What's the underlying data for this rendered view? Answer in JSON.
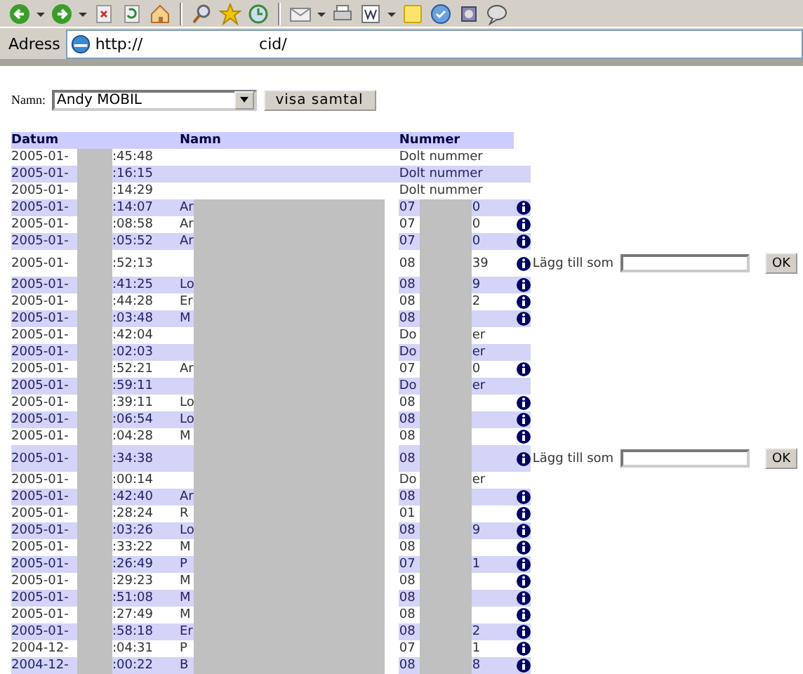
{
  "address_bar": {
    "label": "Adress",
    "url_start": "http://",
    "url_end": "cid/"
  },
  "form": {
    "label": "Namn:",
    "select_value": "Andy MOBIL",
    "button": "visa samtal"
  },
  "table": {
    "columns": [
      "Datum",
      "Namn",
      "Nummer"
    ],
    "rows": [
      {
        "date": "2005-01-",
        "time": ":45:48",
        "redacted": false,
        "name": "",
        "number": "Dolt nummer",
        "number_end": "",
        "info": false
      },
      {
        "date": "2005-01-",
        "time": ":16:15",
        "redacted": false,
        "name": "",
        "number": "Dolt nummer",
        "number_end": "",
        "info": false
      },
      {
        "date": "2005-01-",
        "time": ":14:29",
        "redacted": false,
        "name": "",
        "number": "Dolt nummer",
        "number_end": "",
        "info": false
      },
      {
        "date": "2005-01-",
        "time": ":14:07",
        "redacted": true,
        "name": "Ar",
        "number": "07",
        "number_end": "0",
        "info": true
      },
      {
        "date": "2005-01-",
        "time": ":08:58",
        "redacted": true,
        "name": "Ar",
        "number": "07",
        "number_end": "0",
        "info": true
      },
      {
        "date": "2005-01-",
        "time": ":05:52",
        "redacted": true,
        "name": "Ar",
        "number": "07",
        "number_end": "0",
        "info": true
      },
      {
        "date": "2005-01-",
        "time": ":52:13",
        "redacted": true,
        "name": "",
        "number": "08",
        "number_end": "39",
        "info": true,
        "add_form": {
          "label": "Lägg till som",
          "button": "OK"
        }
      },
      {
        "date": "2005-01-",
        "time": ":41:25",
        "redacted": true,
        "name": "Lo",
        "number": "08",
        "number_end": "9",
        "info": true
      },
      {
        "date": "2005-01-",
        "time": ":44:28",
        "redacted": true,
        "name": "Er",
        "number": "08",
        "number_end": "2",
        "info": true
      },
      {
        "date": "2005-01-",
        "time": ":03:48",
        "redacted": true,
        "name": "M",
        "number": "08",
        "number_end": "",
        "info": true
      },
      {
        "date": "2005-01-",
        "time": ":42:04",
        "redacted": true,
        "name": "",
        "number": "Do",
        "number_end": "er",
        "info": false
      },
      {
        "date": "2005-01-",
        "time": ":02:03",
        "redacted": true,
        "name": "",
        "number": "Do",
        "number_end": "er",
        "info": false
      },
      {
        "date": "2005-01-",
        "time": ":52:21",
        "redacted": true,
        "name": "Ar",
        "number": "07",
        "number_end": "0",
        "info": true
      },
      {
        "date": "2005-01-",
        "time": ":59:11",
        "redacted": true,
        "name": "",
        "number": "Do",
        "number_end": "er",
        "info": false
      },
      {
        "date": "2005-01-",
        "time": ":39:11",
        "redacted": true,
        "name": "Lo",
        "number": "08",
        "number_end": "",
        "info": true
      },
      {
        "date": "2005-01-",
        "time": ":06:54",
        "redacted": true,
        "name": "Lo",
        "number": "08",
        "number_end": "",
        "info": true
      },
      {
        "date": "2005-01-",
        "time": ":04:28",
        "redacted": true,
        "name": "M",
        "number": "08",
        "number_end": "",
        "info": true
      },
      {
        "date": "2005-01-",
        "time": ":34:38",
        "redacted": true,
        "name": "",
        "number": "08",
        "number_end": "",
        "info": true,
        "add_form": {
          "label": "Lägg till som",
          "button": "OK"
        }
      },
      {
        "date": "2005-01-",
        "time": ":00:14",
        "redacted": true,
        "name": "",
        "number": "Do",
        "number_end": "er",
        "info": false
      },
      {
        "date": "2005-01-",
        "time": ":42:40",
        "redacted": true,
        "name": "Ar",
        "number": "08",
        "number_end": "",
        "info": true
      },
      {
        "date": "2005-01-",
        "time": ":28:24",
        "redacted": true,
        "name": "R",
        "number": "01",
        "number_end": "",
        "info": true
      },
      {
        "date": "2005-01-",
        "time": ":03:26",
        "redacted": true,
        "name": "Lo",
        "number": "08",
        "number_end": "9",
        "info": true
      },
      {
        "date": "2005-01-",
        "time": ":33:22",
        "redacted": true,
        "name": "M",
        "number": "08",
        "number_end": "",
        "info": true
      },
      {
        "date": "2005-01-",
        "time": ":26:49",
        "redacted": true,
        "name": "P",
        "number": "07",
        "number_end": "1",
        "info": true
      },
      {
        "date": "2005-01-",
        "time": ":29:23",
        "redacted": true,
        "name": "M",
        "number": "08",
        "number_end": "",
        "info": true
      },
      {
        "date": "2005-01-",
        "time": ":51:08",
        "redacted": true,
        "name": "M",
        "number": "08",
        "number_end": "",
        "info": true
      },
      {
        "date": "2005-01-",
        "time": ":27:49",
        "redacted": true,
        "name": "M",
        "number": "08",
        "number_end": "",
        "info": true
      },
      {
        "date": "2005-01-",
        "time": ":58:18",
        "redacted": true,
        "name": "Er",
        "number": "08",
        "number_end": "2",
        "info": true
      },
      {
        "date": "2004-12-",
        "time": ":04:31",
        "redacted": true,
        "name": "P",
        "number": "07",
        "number_end": "1",
        "info": true
      },
      {
        "date": "2004-12-",
        "time": ":00:22",
        "redacted": true,
        "name": "B",
        "number": "08",
        "number_end": "8",
        "info": true
      }
    ]
  }
}
